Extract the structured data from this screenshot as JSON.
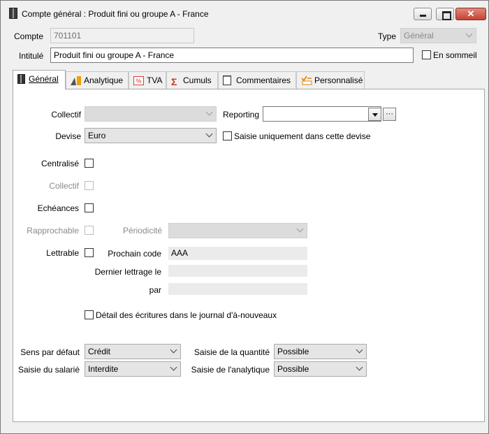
{
  "window": {
    "title": "Compte général : Produit fini ou groupe A - France",
    "min_icon": "minimize-icon",
    "max_icon": "maximize-icon",
    "close_glyph": "✕"
  },
  "header": {
    "compte_label": "Compte",
    "compte_value": "701101",
    "type_label": "Type",
    "type_value": "Général",
    "intitule_label": "Intitulé",
    "intitule_value": "Produit fini ou groupe A - France",
    "en_sommeil_label": "En sommeil"
  },
  "tabs": [
    {
      "label": "Général",
      "icon": "general-icon",
      "active": true
    },
    {
      "label": "Analytique",
      "icon": "analytique-icon"
    },
    {
      "label": "TVA",
      "icon": "tva-icon"
    },
    {
      "label": "Cumuls",
      "icon": "sigma-icon"
    },
    {
      "label": "Commentaires",
      "icon": "note-icon"
    },
    {
      "label": "Personnalisé",
      "icon": "custom-icon"
    }
  ],
  "general": {
    "collectif_label": "Collectif",
    "collectif_value": "",
    "reporting_label": "Reporting",
    "reporting_value": "",
    "reporting_more": "···",
    "devise_label": "Devise",
    "devise_value": "Euro",
    "saisie_devise_label": "Saisie uniquement dans cette devise",
    "centralise_label": "Centralisé",
    "collectif2_label": "Collectif",
    "echeances_label": "Echéances",
    "rapprochable_label": "Rapprochable",
    "periodicite_label": "Périodicité",
    "periodicite_value": "",
    "lettrable_label": "Lettrable",
    "prochain_code_label": "Prochain code",
    "prochain_code_value": "AAA",
    "dernier_lettrage_label": "Dernier lettrage le",
    "dernier_lettrage_value": "",
    "par_label": "par",
    "par_value": "",
    "detail_label": "Détail des écritures dans le journal d'à-nouveaux",
    "sens_label": "Sens par défaut",
    "sens_value": "Crédit",
    "saisie_quantite_label": "Saisie de la quantité",
    "saisie_quantite_value": "Possible",
    "saisie_salarie_label": "Saisie du salarié",
    "saisie_salarie_value": "Interdite",
    "saisie_analytique_label": "Saisie de l'analytique",
    "saisie_analytique_value": "Possible"
  }
}
